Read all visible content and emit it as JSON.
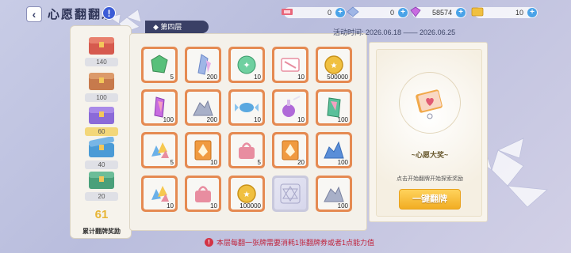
{
  "header": {
    "back_icon": "back-arrow-icon",
    "title": "心愿翻翻乐",
    "info_icon": "info-icon"
  },
  "currencies": [
    {
      "icon": "ticket-icon",
      "value": "0",
      "color": "#e8667a"
    },
    {
      "icon": "crystal-icon",
      "value": "0",
      "color": "#9fb6e6"
    },
    {
      "icon": "gem-icon",
      "value": "58574",
      "color": "#c86be0"
    },
    {
      "icon": "card-icon",
      "value": "10",
      "color": "#f0c040"
    }
  ],
  "chests": [
    {
      "icon": "red-chest-icon",
      "count": "140",
      "color": "#d65a4e"
    },
    {
      "icon": "brown-chest-icon",
      "count": "100",
      "color": "#c77a4c"
    },
    {
      "icon": "purple-chest-icon",
      "count": "60",
      "color": "#8b6ad8"
    },
    {
      "icon": "blue-chest-icon",
      "count": "40",
      "color": "#4b9bd6"
    },
    {
      "icon": "green-chest-icon",
      "count": "20",
      "color": "#4aa07a"
    }
  ],
  "total": {
    "value": "61",
    "label": "累计翻牌奖励"
  },
  "floor_label": "第四层",
  "date_range": "活动时间:  2026.06.18 —— 2026.06.25",
  "cards": [
    {
      "icon": "green-gem-icon",
      "qty": "5",
      "color": "#58c07a"
    },
    {
      "icon": "crystal-shard-icon",
      "qty": "200",
      "color": "#9fb6e6"
    },
    {
      "icon": "green-orb-icon",
      "qty": "10",
      "color": "#6fd0a0"
    },
    {
      "icon": "ticket-icon",
      "qty": "10",
      "color": "#e88da0"
    },
    {
      "icon": "gold-coin-icon",
      "qty": "500000",
      "color": "#f0c040"
    },
    {
      "icon": "rainbow-crystal-icon",
      "qty": "100",
      "color": "#c86be0"
    },
    {
      "icon": "silver-ore-icon",
      "qty": "200",
      "color": "#a8b0c8"
    },
    {
      "icon": "blue-candy-icon",
      "qty": "10",
      "color": "#5aa8e0"
    },
    {
      "icon": "purple-potion-icon",
      "qty": "10",
      "color": "#b06ad8"
    },
    {
      "icon": "green-crystal-icon",
      "qty": "100",
      "color": "#5ac09a"
    },
    {
      "icon": "colorful-shards-icon",
      "qty": "5",
      "color": "#6ab0e8"
    },
    {
      "icon": "orange-card-icon",
      "qty": "10",
      "color": "#f09a40"
    },
    {
      "icon": "pink-bag-icon",
      "qty": "5",
      "color": "#e88da0"
    },
    {
      "icon": "orange-card-icon",
      "qty": "20",
      "color": "#f09a40"
    },
    {
      "icon": "blue-ore-icon",
      "qty": "100",
      "color": "#5a8ed8"
    },
    {
      "icon": "colorful-shards-icon",
      "qty": "10",
      "color": "#6ab0e8"
    },
    {
      "icon": "pink-bag-icon",
      "qty": "10",
      "color": "#e88da0"
    },
    {
      "icon": "gold-coin-icon",
      "qty": "100000",
      "color": "#f0c040"
    },
    {
      "icon": "card-back-icon",
      "qty": "",
      "color": "#c9c9dd"
    },
    {
      "icon": "silver-ore-icon",
      "qty": "100",
      "color": "#a8b0c8"
    }
  ],
  "reward": {
    "icon": "heart-card-icon",
    "name": "~心愿大奖~",
    "hint": "点击开始翻牌开始探索奖励"
  },
  "flip_button": "一键翻牌",
  "note": "本层每翻一张牌需要消耗1张翻牌券或者1点能力值"
}
